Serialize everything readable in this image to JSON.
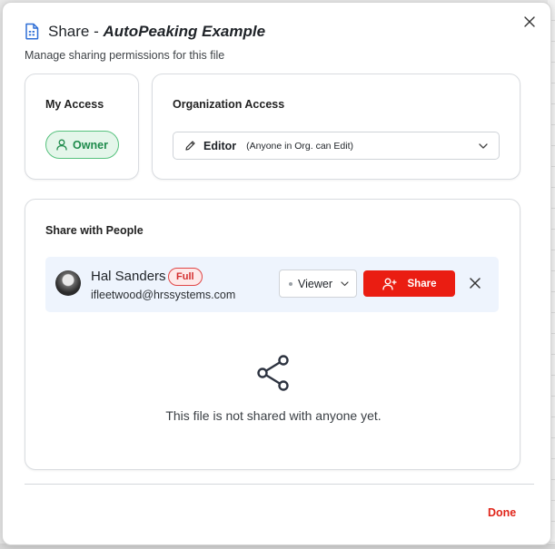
{
  "dialog": {
    "title_prefix": "Share -",
    "file_name": "AutoPeaking Example",
    "subtitle": "Manage sharing permissions for this file",
    "close_icon": "close-icon"
  },
  "my_access": {
    "title": "My Access",
    "badge_label": "Owner",
    "badge_icon": "user-icon"
  },
  "org_access": {
    "title": "Organization Access",
    "role": "Editor",
    "description": "(Anyone in Org. can Edit)",
    "icon": "pencil-icon"
  },
  "share_people": {
    "title": "Share with People",
    "person": {
      "name": "Hal Sanders",
      "badge": "Full",
      "email": "ifleetwood@hrssystems.com",
      "role": "Viewer"
    },
    "share_button": "Share",
    "empty_text": "This file is not shared with anyone yet."
  },
  "footer": {
    "done_label": "Done"
  },
  "colors": {
    "accent_red": "#ea1d12",
    "owner_green": "#1f8b4c",
    "row_bg": "#eef4fd"
  }
}
